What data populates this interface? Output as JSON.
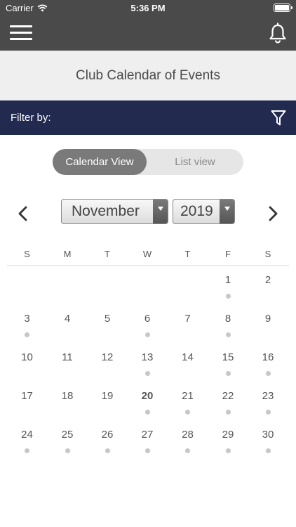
{
  "status_bar": {
    "carrier": "Carrier",
    "time": "5:36 PM"
  },
  "nav": {
    "menu_icon": "hamburger-menu-icon",
    "notifications_icon": "bell-icon"
  },
  "header": {
    "title": "Club Calendar of Events"
  },
  "filter": {
    "label": "Filter by:",
    "icon": "funnel-filter-icon",
    "background": "#222a50"
  },
  "view_toggle": {
    "options": [
      "Calendar View",
      "List view"
    ],
    "selected": "Calendar View"
  },
  "calendar": {
    "month": "November",
    "year": "2019",
    "weekdays": [
      "S",
      "M",
      "T",
      "W",
      "T",
      "F",
      "S"
    ],
    "today": 20,
    "event_days": [
      1,
      3,
      6,
      8,
      13,
      15,
      16,
      20,
      21,
      22,
      23,
      24,
      25,
      26,
      27,
      28,
      29,
      30
    ],
    "weeks": [
      [
        "",
        "",
        "",
        "",
        "",
        "1",
        "2"
      ],
      [
        "3",
        "4",
        "5",
        "6",
        "7",
        "8",
        "9"
      ],
      [
        "10",
        "11",
        "12",
        "13",
        "14",
        "15",
        "16"
      ],
      [
        "17",
        "18",
        "19",
        "20",
        "21",
        "22",
        "23"
      ],
      [
        "24",
        "25",
        "26",
        "27",
        "28",
        "29",
        "30"
      ]
    ]
  },
  "colors": {
    "nav_background": "#4a4a4a",
    "toggle_active": "#7a7a7a",
    "event_dot": "#c7c7c7"
  }
}
